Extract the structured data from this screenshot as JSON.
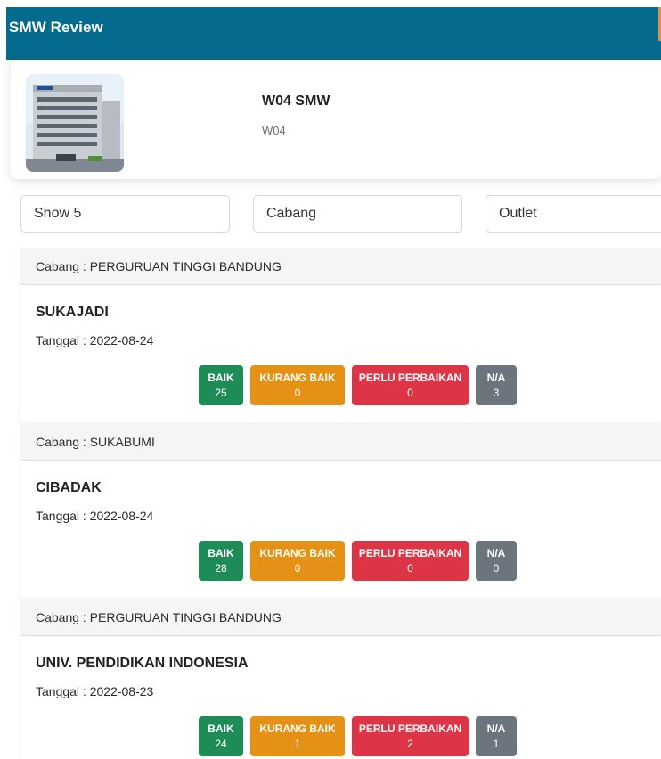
{
  "header": {
    "title": "SMW Review"
  },
  "profile": {
    "name": "W04 SMW",
    "code": "W04",
    "photo_icon": "office-building-photo"
  },
  "filters": {
    "show": "Show 5",
    "cabang": "Cabang",
    "outlet": "Outlet"
  },
  "badge_labels": {
    "baik": "BAIK",
    "kurang": "KURANG BAIK",
    "perlu": "PERLU PERBAIKAN",
    "na": "N/A"
  },
  "colors": {
    "header": "#046b8e",
    "baik": "#1e8c57",
    "kurang": "#e49115",
    "perlu": "#dd3545",
    "na": "#6c757d"
  },
  "entries": [
    {
      "group": "Cabang : PERGURUAN TINGGI BANDUNG",
      "name": "SUKAJADI",
      "date": "Tanggal : 2022-08-24",
      "baik": "25",
      "kurang": "0",
      "perlu": "0",
      "na": "3"
    },
    {
      "group": "Cabang : SUKABUMI",
      "name": "CIBADAK",
      "date": "Tanggal : 2022-08-24",
      "baik": "28",
      "kurang": "0",
      "perlu": "0",
      "na": "0"
    },
    {
      "group": "Cabang : PERGURUAN TINGGI BANDUNG",
      "name": "UNIV. PENDIDIKAN INDONESIA",
      "date": "Tanggal : 2022-08-23",
      "baik": "24",
      "kurang": "1",
      "perlu": "2",
      "na": "1"
    }
  ]
}
